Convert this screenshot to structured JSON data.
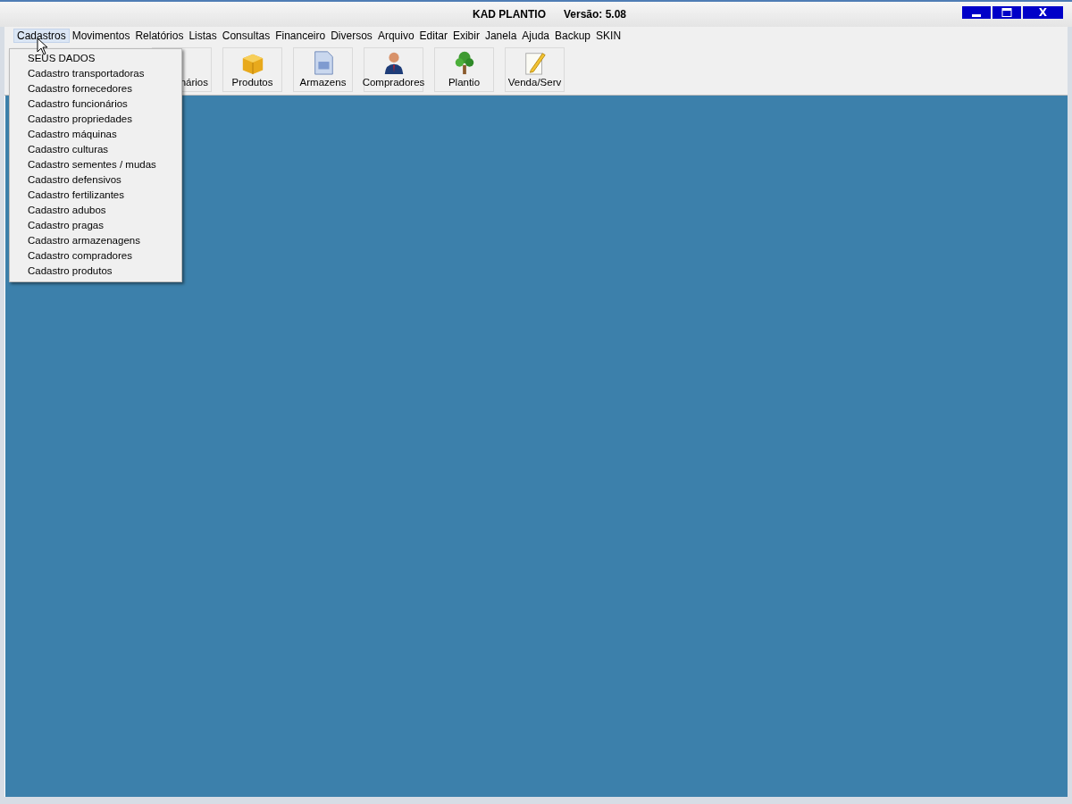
{
  "window": {
    "title": "KAD PLANTIO",
    "version": "Versão: 5.08",
    "close_label": "X"
  },
  "menu_bar": [
    {
      "label": "Cadastros",
      "selected": true
    },
    {
      "label": "Movimentos",
      "selected": false
    },
    {
      "label": "Relatórios",
      "selected": false
    },
    {
      "label": "Listas",
      "selected": false
    },
    {
      "label": "Consultas",
      "selected": false
    },
    {
      "label": "Financeiro",
      "selected": false
    },
    {
      "label": "Diversos",
      "selected": false
    },
    {
      "label": "Arquivo",
      "selected": false
    },
    {
      "label": "Editar",
      "selected": false
    },
    {
      "label": "Exibir",
      "selected": false
    },
    {
      "label": "Janela",
      "selected": false
    },
    {
      "label": "Ajuda",
      "selected": false
    },
    {
      "label": "Backup",
      "selected": false
    },
    {
      "label": "SKIN",
      "selected": false
    }
  ],
  "toolbar": [
    {
      "label": "nários",
      "kind": "partial"
    },
    {
      "label": "Produtos",
      "kind": "box"
    },
    {
      "label": "Armazens",
      "kind": "document"
    },
    {
      "label": "Compradores",
      "kind": "person"
    },
    {
      "label": "Plantio",
      "kind": "tree"
    },
    {
      "label": "Venda/Serv",
      "kind": "pencil"
    }
  ],
  "dropdown": [
    "SEUS DADOS",
    "Cadastro transportadoras",
    "Cadastro fornecedores",
    "Cadastro funcionários",
    "Cadastro propriedades",
    "Cadastro máquinas",
    "Cadastro culturas",
    "Cadastro sementes / mudas",
    "Cadastro defensivos",
    "Cadastro fertilizantes",
    "Cadastro adubos",
    "Cadastro pragas",
    "Cadastro armazenagens",
    "Cadastro compradores",
    "Cadastro produtos"
  ]
}
